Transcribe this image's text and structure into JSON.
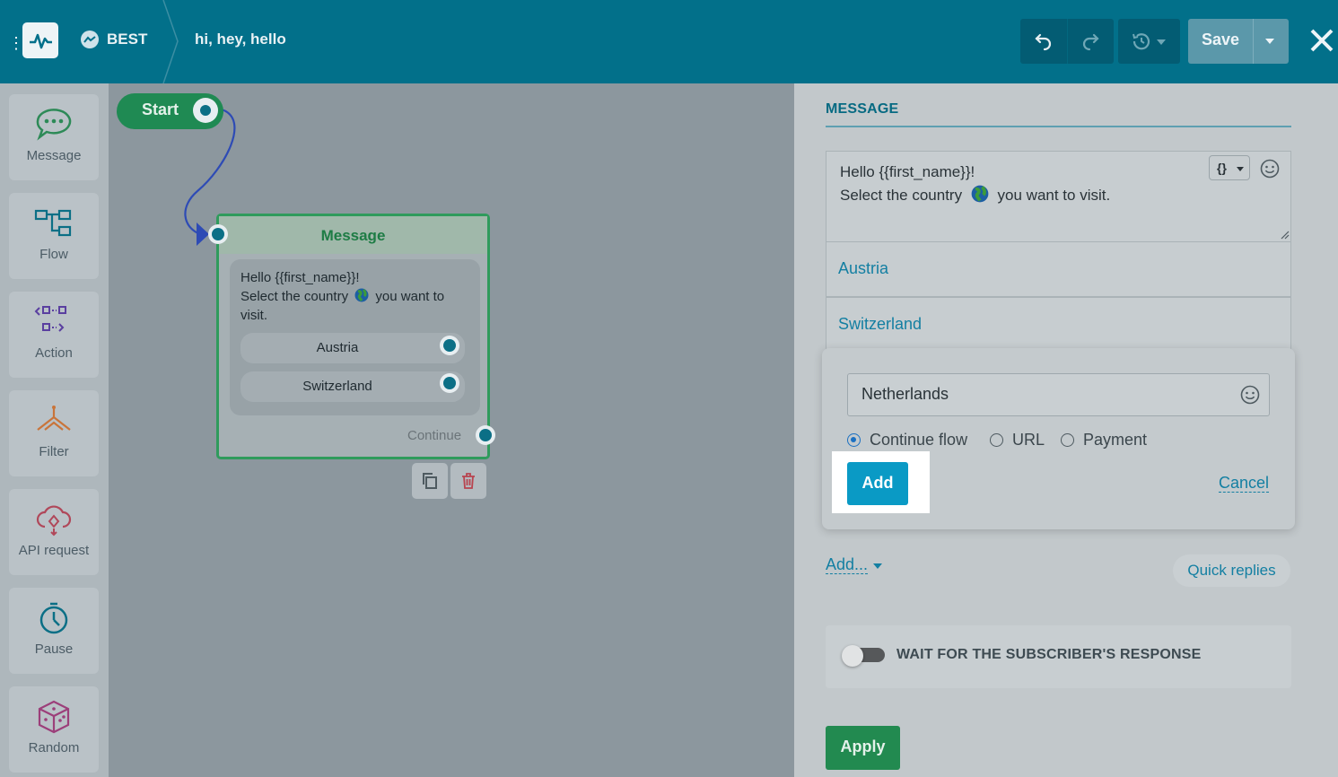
{
  "header": {
    "bot_name": "BEST",
    "flow_name": "hi, hey, hello",
    "save_label": "Save"
  },
  "sidebar": {
    "items": [
      {
        "label": "Message",
        "icon": "message-bubble-icon"
      },
      {
        "label": "Flow",
        "icon": "flow-icon"
      },
      {
        "label": "Action",
        "icon": "action-icon"
      },
      {
        "label": "Filter",
        "icon": "filter-icon"
      },
      {
        "label": "API request",
        "icon": "cloud-api-icon"
      },
      {
        "label": "Pause",
        "icon": "stopwatch-icon"
      },
      {
        "label": "Random",
        "icon": "dice-icon"
      }
    ]
  },
  "canvas": {
    "start_label": "Start",
    "message_node": {
      "title": "Message",
      "text_line1": "Hello  {{first_name}}!",
      "text_line2": "Select the country",
      "text_line2b": "you want to",
      "text_line3": "visit.",
      "buttons": [
        "Austria",
        "Switzerland"
      ],
      "continue_label": "Continue"
    }
  },
  "panel": {
    "title": "MESSAGE",
    "editor_line1": "Hello  {{first_name}}!",
    "editor_line2a": "Select the country",
    "editor_line2b": "you want to visit.",
    "var_button": "{}",
    "buttons": [
      "Austria",
      "Switzerland"
    ],
    "new_button": {
      "value": "Netherlands",
      "options": [
        "Continue flow",
        "URL",
        "Payment"
      ],
      "selected": "Continue flow",
      "add_label": "Add",
      "cancel_label": "Cancel"
    },
    "add_dropdown": "Add...",
    "quick_replies": "Quick replies",
    "wait_label": "WAIT FOR THE SUBSCRIBER'S RESPONSE",
    "apply_label": "Apply"
  },
  "colors": {
    "header": "#02708a",
    "accent": "#0a9ac5",
    "green": "#228a50",
    "link": "#137fa2"
  }
}
